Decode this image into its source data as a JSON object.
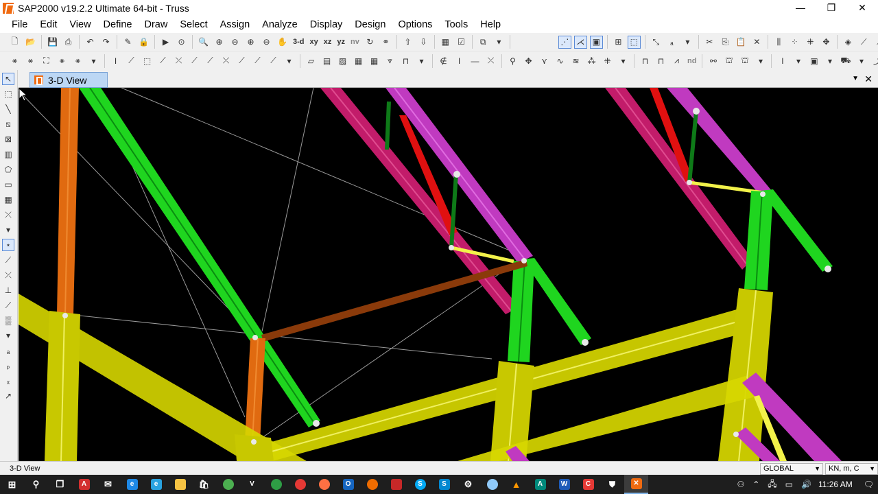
{
  "window": {
    "title": "SAP2000 v19.2.2 Ultimate 64-bit - Truss",
    "minimize": "—",
    "restore": "❐",
    "close": "✕"
  },
  "menu": [
    "File",
    "Edit",
    "View",
    "Define",
    "Draw",
    "Select",
    "Assign",
    "Analyze",
    "Display",
    "Design",
    "Options",
    "Tools",
    "Help"
  ],
  "toolbar1_text": {
    "view_3d": "3-d",
    "view_xy": "xy",
    "view_xz": "xz",
    "view_yz": "yz",
    "view_nv": "nv"
  },
  "toolbar2_text": {
    "nd": "nd"
  },
  "tab": {
    "label": "3-D View",
    "dropdown": "▼",
    "close": "✕"
  },
  "status": {
    "left": "3-D View",
    "coord_system": "GLOBAL",
    "units": "KN, m, C"
  },
  "clock": "11:26 AM",
  "colors": {
    "yellow": "#d7d700",
    "green": "#1fd51f",
    "magenta": "#c03ac0",
    "pink": "#c21c6a",
    "orange": "#e06a10",
    "brown": "#8a3a0a",
    "red": "#e01010",
    "darkgreen": "#0e7a18",
    "lightyellow": "#f2f24a"
  }
}
